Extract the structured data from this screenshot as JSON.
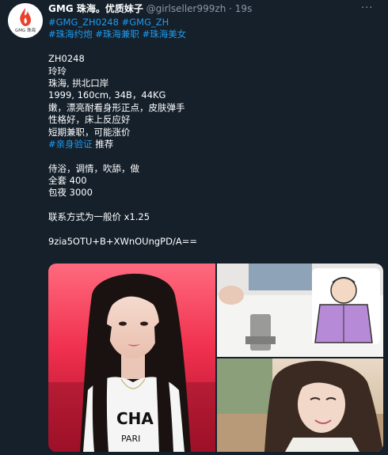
{
  "tweet": {
    "avatar_label": "GMG 珠海",
    "name": "GMG 珠海。优质妹子",
    "handle": "@girlseller999zh",
    "separator": "·",
    "time": "19s",
    "more_label": "···",
    "hashtags_line1": [
      "#GMG_ZH0248",
      "#GMG_ZH"
    ],
    "hashtags_line2": [
      "#珠海约炮",
      "#珠海兼职",
      "#珠海美女"
    ],
    "lines": [
      "ZH0248",
      "玲玲",
      "珠海, 拱北口岸",
      "1999, 160cm, 34B，44KG",
      "嫩，漂亮耐看身形正点，皮肤弹手",
      "性格好，床上反应好",
      "短期兼职，可能涨价"
    ],
    "verify_tag": "#亲身验证",
    "verify_text": " 推荐",
    "services": "侍浴，调情，吹舔，做",
    "price_full": "全套 400",
    "price_night": "包夜 3000",
    "contact_note": "联系方式为一般价 x1.25",
    "code": "9zia5OTU+B+XWnOUngPD/A==",
    "shirt_text_1": "CHA",
    "shirt_text_2": "PARI",
    "colors": {
      "background": "#15202b",
      "text": "#ffffff",
      "secondary": "#8b98a5",
      "link": "#1d9bf0",
      "avatar_red": "#e8412c"
    }
  }
}
